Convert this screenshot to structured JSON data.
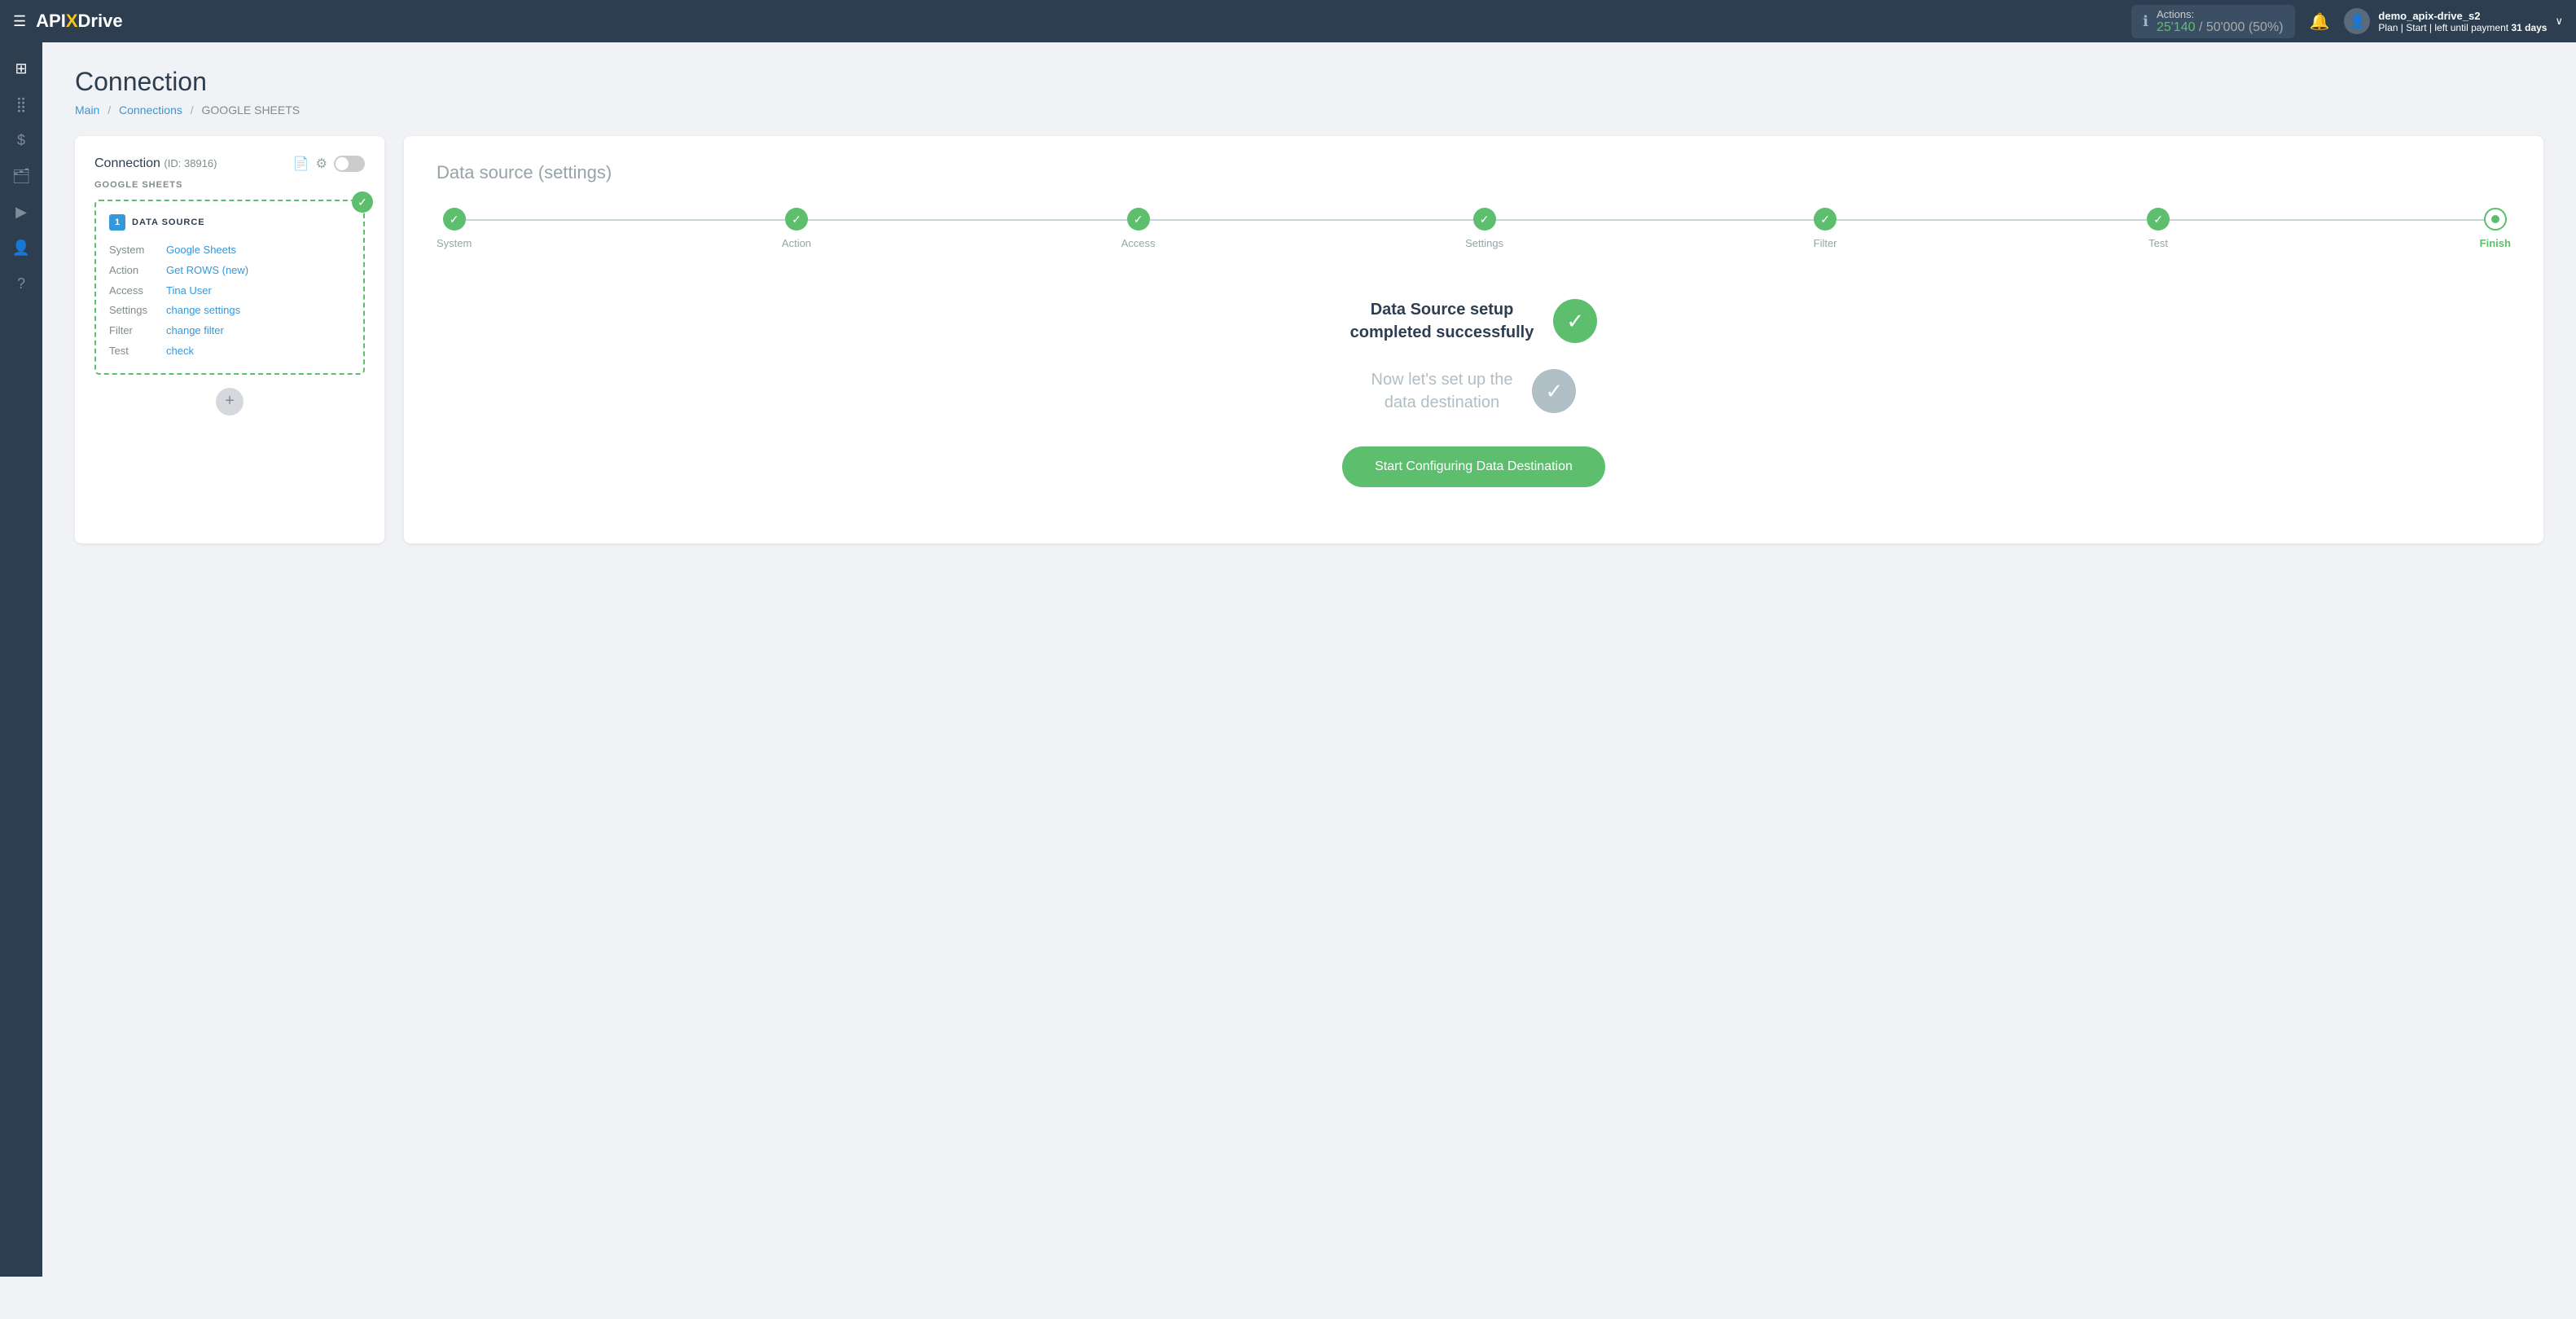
{
  "navbar": {
    "menu_icon": "☰",
    "logo_pre": "API",
    "logo_x": "X",
    "logo_post": "Drive",
    "actions_label": "Actions:",
    "actions_used": "25'140",
    "actions_total": "50'000",
    "actions_pct": "50%",
    "bell_icon": "🔔",
    "user_icon": "👤",
    "user_name": "demo_apix-drive_s2",
    "user_plan_pre": "Plan |",
    "user_plan_type": "Start",
    "user_plan_mid": "| left until payment",
    "user_days": "31 days",
    "chevron": "∨"
  },
  "sidebar": {
    "items": [
      {
        "icon": "⊞",
        "name": "home"
      },
      {
        "icon": "⋮⋮",
        "name": "dashboard"
      },
      {
        "icon": "$",
        "name": "billing"
      },
      {
        "icon": "🗂",
        "name": "connections"
      },
      {
        "icon": "▶",
        "name": "run"
      },
      {
        "icon": "👤",
        "name": "profile"
      },
      {
        "icon": "?",
        "name": "help"
      }
    ]
  },
  "page": {
    "title": "Connection",
    "breadcrumb": {
      "main": "Main",
      "connections": "Connections",
      "current": "GOOGLE SHEETS"
    }
  },
  "left_card": {
    "title_pre": "Connection",
    "title_id": "(ID: 38916)",
    "doc_icon": "📄",
    "gear_icon": "⚙",
    "subtitle": "GOOGLE SHEETS",
    "datasource": {
      "num": "1",
      "label": "DATA SOURCE",
      "rows": [
        {
          "key": "System",
          "val": "Google Sheets"
        },
        {
          "key": "Action",
          "val": "Get ROWS (new)"
        },
        {
          "key": "Access",
          "val": "Tina User"
        },
        {
          "key": "Settings",
          "val": "change settings"
        },
        {
          "key": "Filter",
          "val": "change filter"
        },
        {
          "key": "Test",
          "val": "check"
        }
      ]
    },
    "add_icon": "+"
  },
  "right_card": {
    "title": "Data source",
    "title_sub": "(settings)",
    "steps": [
      {
        "label": "System",
        "state": "done"
      },
      {
        "label": "Action",
        "state": "done"
      },
      {
        "label": "Access",
        "state": "done"
      },
      {
        "label": "Settings",
        "state": "done"
      },
      {
        "label": "Filter",
        "state": "done"
      },
      {
        "label": "Test",
        "state": "done"
      },
      {
        "label": "Finish",
        "state": "finish"
      }
    ],
    "success_primary": "Data Source setup\ncompleted successfully",
    "success_secondary": "Now let's set up the\ndata destination",
    "start_btn": "Start Configuring Data Destination"
  }
}
